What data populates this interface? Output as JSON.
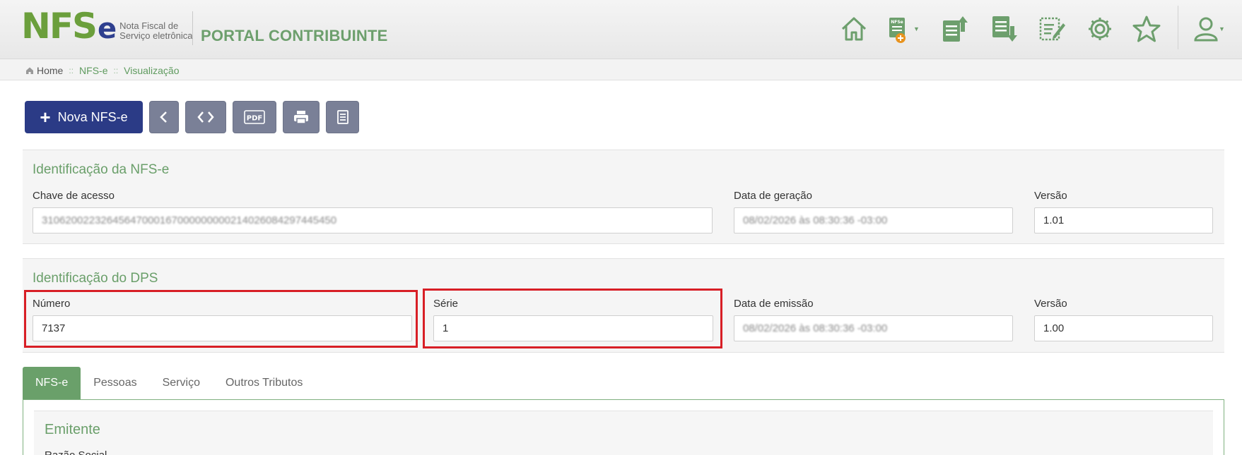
{
  "header": {
    "logo_text": "NFS",
    "logo_e": "e",
    "logo_sub_line1": "Nota Fiscal de",
    "logo_sub_line2": "Serviço eletrônica",
    "portal_title": "PORTAL CONTRIBUINTE",
    "new_doc_icon_badge": "NFSe",
    "icons": [
      "home-icon",
      "new-nfse-icon",
      "upload-document-icon",
      "download-document-icon",
      "edit-document-icon",
      "settings-gear-icon",
      "favorites-star-icon",
      "user-profile-icon"
    ],
    "accent_color": "#6d9f6d"
  },
  "breadcrumb": {
    "items": [
      "Home",
      "NFS-e",
      "Visualização"
    ],
    "separator": "::"
  },
  "toolbar": {
    "new_button_label": "Nova NFS-e",
    "pdf_label": "PDF",
    "buttons": [
      "back-chevron-icon",
      "code-icon",
      "pdf-icon",
      "print-icon",
      "document-icon"
    ]
  },
  "nfse_identification": {
    "title": "Identificação da NFS-e",
    "chave_label": "Chave de acesso",
    "chave_value": "31062002232645647000167000000000214026084297445450",
    "data_geracao_label": "Data de geração",
    "data_geracao_value": "08/02/2026 às 08:30:36 -03:00",
    "versao_label": "Versão",
    "versao_value": "1.01"
  },
  "dps_identification": {
    "title": "Identificação do DPS",
    "numero_label": "Número",
    "numero_value": "7137",
    "serie_label": "Série",
    "serie_value": "1",
    "data_emissao_label": "Data de emissão",
    "data_emissao_value": "08/02/2026 às 08:30:36 -03:00",
    "versao_label": "Versão",
    "versao_value": "1.00"
  },
  "tabs": [
    {
      "label": "NFS-e",
      "active": true
    },
    {
      "label": "Pessoas",
      "active": false
    },
    {
      "label": "Serviço",
      "active": false
    },
    {
      "label": "Outros Tributos",
      "active": false
    }
  ],
  "emitente": {
    "title": "Emitente",
    "razao_social_label": "Razão Social"
  }
}
